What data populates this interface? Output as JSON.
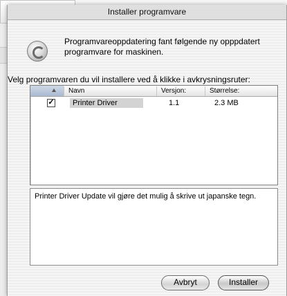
{
  "window": {
    "title": "Installer programvare"
  },
  "header": {
    "icon": "software-update-icon",
    "text": "Programvareoppdatering fant følgende ny opppdatert programvare for maskinen."
  },
  "instruction": "Velg programvaren du vil installere ved å klikke i avkrysningsruter:",
  "table": {
    "columns": [
      "Navn",
      "Versjon:",
      "Størrelse:"
    ],
    "rows": [
      {
        "checked": "✓",
        "name": "Printer Driver",
        "version": "1.1",
        "size": "2.3 MB"
      }
    ]
  },
  "description": "Printer Driver Update vil gjøre det mulig å skrive ut japanske tegn.",
  "buttons": {
    "cancel": "Avbryt",
    "install": "Installer"
  }
}
